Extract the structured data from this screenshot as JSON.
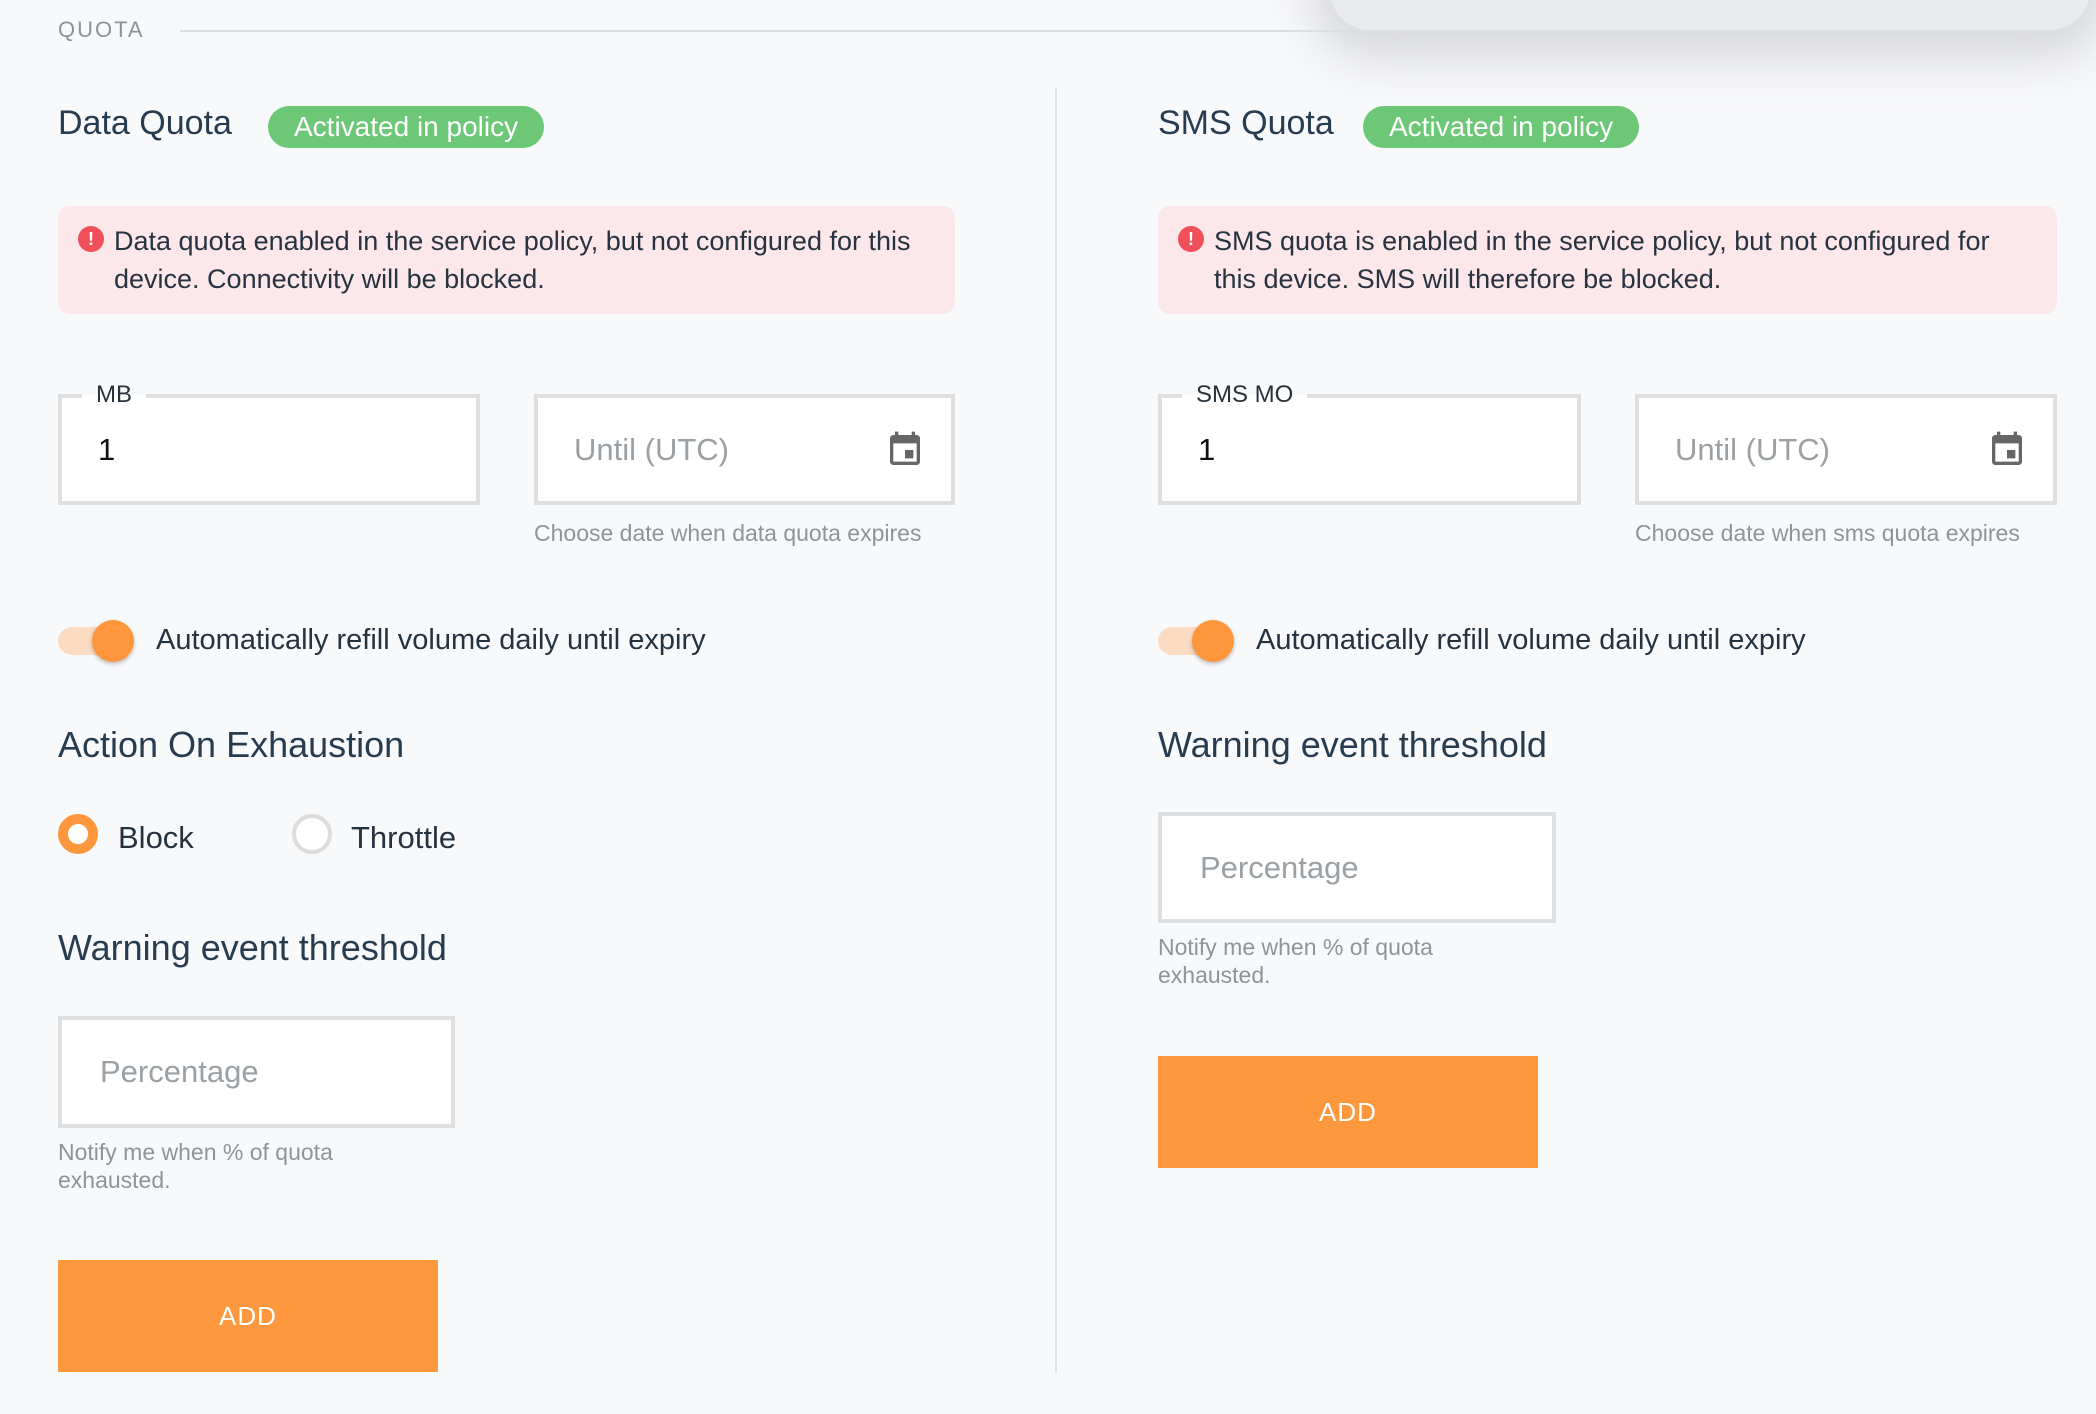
{
  "section": {
    "label": "QUOTA"
  },
  "data_quota": {
    "title": "Data Quota",
    "badge": "Activated in policy",
    "alert_icon": "exclamation-icon",
    "alert_text": "Data quota enabled in the service policy, but not configured for this device. Connectivity will be blocked.",
    "volume_field": {
      "label": "MB",
      "value": "1"
    },
    "until_field": {
      "placeholder": "Until (UTC)",
      "helper": "Choose date when data quota expires",
      "icon": "calendar-icon"
    },
    "auto_refill": {
      "label": "Automatically refill volume daily until expiry",
      "checked": true
    },
    "action_heading": "Action On Exhaustion",
    "action_options": [
      {
        "label": "Block",
        "selected": true
      },
      {
        "label": "Throttle",
        "selected": false
      }
    ],
    "threshold_heading": "Warning event threshold",
    "threshold_field": {
      "placeholder": "Percentage",
      "helper_line1": "Notify me when % of quota",
      "helper_line2": "exhausted."
    },
    "add_label": "ADD"
  },
  "sms_quota": {
    "title": "SMS Quota",
    "badge": "Activated in policy",
    "alert_icon": "exclamation-icon",
    "alert_text": "SMS quota is enabled in the service policy, but not configured for this device. SMS will therefore be blocked.",
    "volume_field": {
      "label": "SMS MO",
      "value": "1"
    },
    "until_field": {
      "placeholder": "Until (UTC)",
      "helper": "Choose date when sms quota expires",
      "icon": "calendar-icon"
    },
    "auto_refill": {
      "label": "Automatically refill volume daily until expiry",
      "checked": true
    },
    "threshold_heading": "Warning event threshold",
    "threshold_field": {
      "placeholder": "Percentage",
      "helper_line1": "Notify me when % of quota",
      "helper_line2": "exhausted."
    },
    "add_label": "ADD"
  },
  "colors": {
    "accent": "#fd963c",
    "badge": "#6cc877",
    "alert_bg": "#fce7ea",
    "alert_icon": "#f0505a"
  }
}
